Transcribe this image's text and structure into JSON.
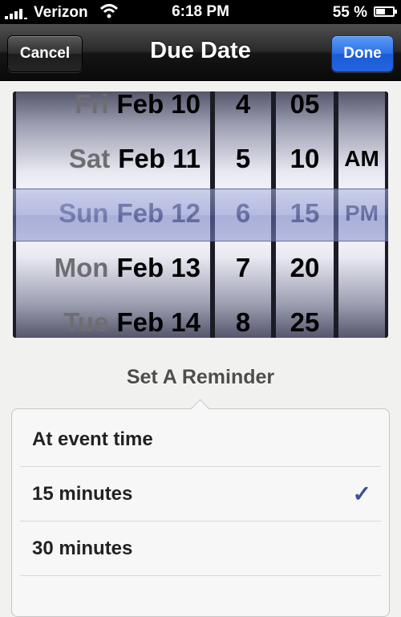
{
  "status_bar": {
    "carrier": "Verizon",
    "time": "6:18 PM",
    "battery_percent": "55 %",
    "battery_level": 0.55
  },
  "nav": {
    "title": "Due Date",
    "cancel_label": "Cancel",
    "done_label": "Done"
  },
  "picker": {
    "dates": [
      {
        "day": "Fri",
        "date": "Feb 10"
      },
      {
        "day": "Sat",
        "date": "Feb 11"
      },
      {
        "day": "Sun",
        "date": "Feb 12"
      },
      {
        "day": "Mon",
        "date": "Feb 13"
      },
      {
        "day": "Tue",
        "date": "Feb 14"
      }
    ],
    "hours": [
      "4",
      "5",
      "6",
      "7",
      "8"
    ],
    "minutes": [
      "05",
      "10",
      "15",
      "20",
      "25"
    ],
    "ampm": [
      "AM",
      "PM"
    ],
    "selected": {
      "day": "Sun",
      "date": "Feb 12",
      "hour": "6",
      "minute": "15",
      "ampm": "PM"
    }
  },
  "reminder": {
    "title": "Set A Reminder",
    "options": [
      "At event time",
      "15 minutes",
      "30 minutes"
    ],
    "selected": "15 minutes",
    "check_glyph": "✓"
  },
  "colors": {
    "done_accent": "#2465de",
    "check": "#3a5496"
  }
}
